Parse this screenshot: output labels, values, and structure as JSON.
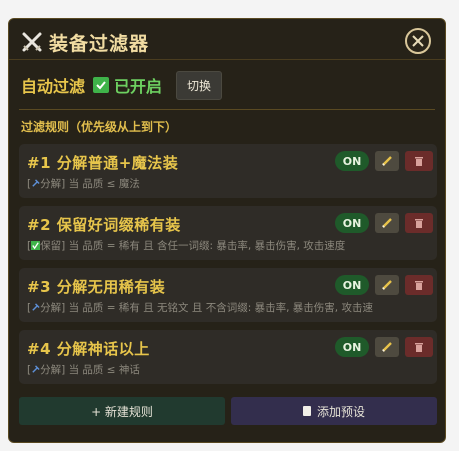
{
  "window": {
    "title": "装备过滤器",
    "title_icon": "crossed-swords-icon",
    "close_icon": "close-icon"
  },
  "auto_filter": {
    "label": "自动过滤",
    "checked": true,
    "status": "已开启",
    "toggle_label": "切换"
  },
  "rules_section": {
    "title": "过滤规则（优先级从上到下）"
  },
  "rules": [
    {
      "name": "#1 分解普通+魔法装",
      "tag": "[",
      "tag_icon": "hammer-icon",
      "tag_text": "分解]",
      "condition": "当 品质 ≤ 魔法",
      "on_label": "ON"
    },
    {
      "name": "#2 保留好词缀稀有装",
      "tag": "[",
      "tag_icon": "checkbox-icon",
      "tag_text": "保留]",
      "condition": "当 品质 = 稀有 且 含任一词缀: 暴击率, 暴击伤害, 攻击速度",
      "on_label": "ON"
    },
    {
      "name": "#3 分解无用稀有装",
      "tag": "[",
      "tag_icon": "hammer-icon",
      "tag_text": "分解]",
      "condition": "当 品质 = 稀有 且 无铭文 且 不含词缀: 暴击率, 暴击伤害, 攻击速",
      "on_label": "ON"
    },
    {
      "name": "#4 分解神话以上",
      "tag": "[",
      "tag_icon": "hammer-icon",
      "tag_text": "分解]",
      "condition": "当 品质 ≤ 神话",
      "on_label": "ON"
    }
  ],
  "footer": {
    "new_rule_label": "+ 新建规则",
    "add_preset_label": "添加预设",
    "add_preset_icon": "document-icon"
  },
  "colors": {
    "panel_bg": "#262218",
    "accent_gold": "#e7c54b",
    "on_green": "#1f5a2a",
    "delete_red": "#6b2c2a",
    "new_rule_bg": "#213a2f",
    "preset_bg": "#332e4d"
  }
}
